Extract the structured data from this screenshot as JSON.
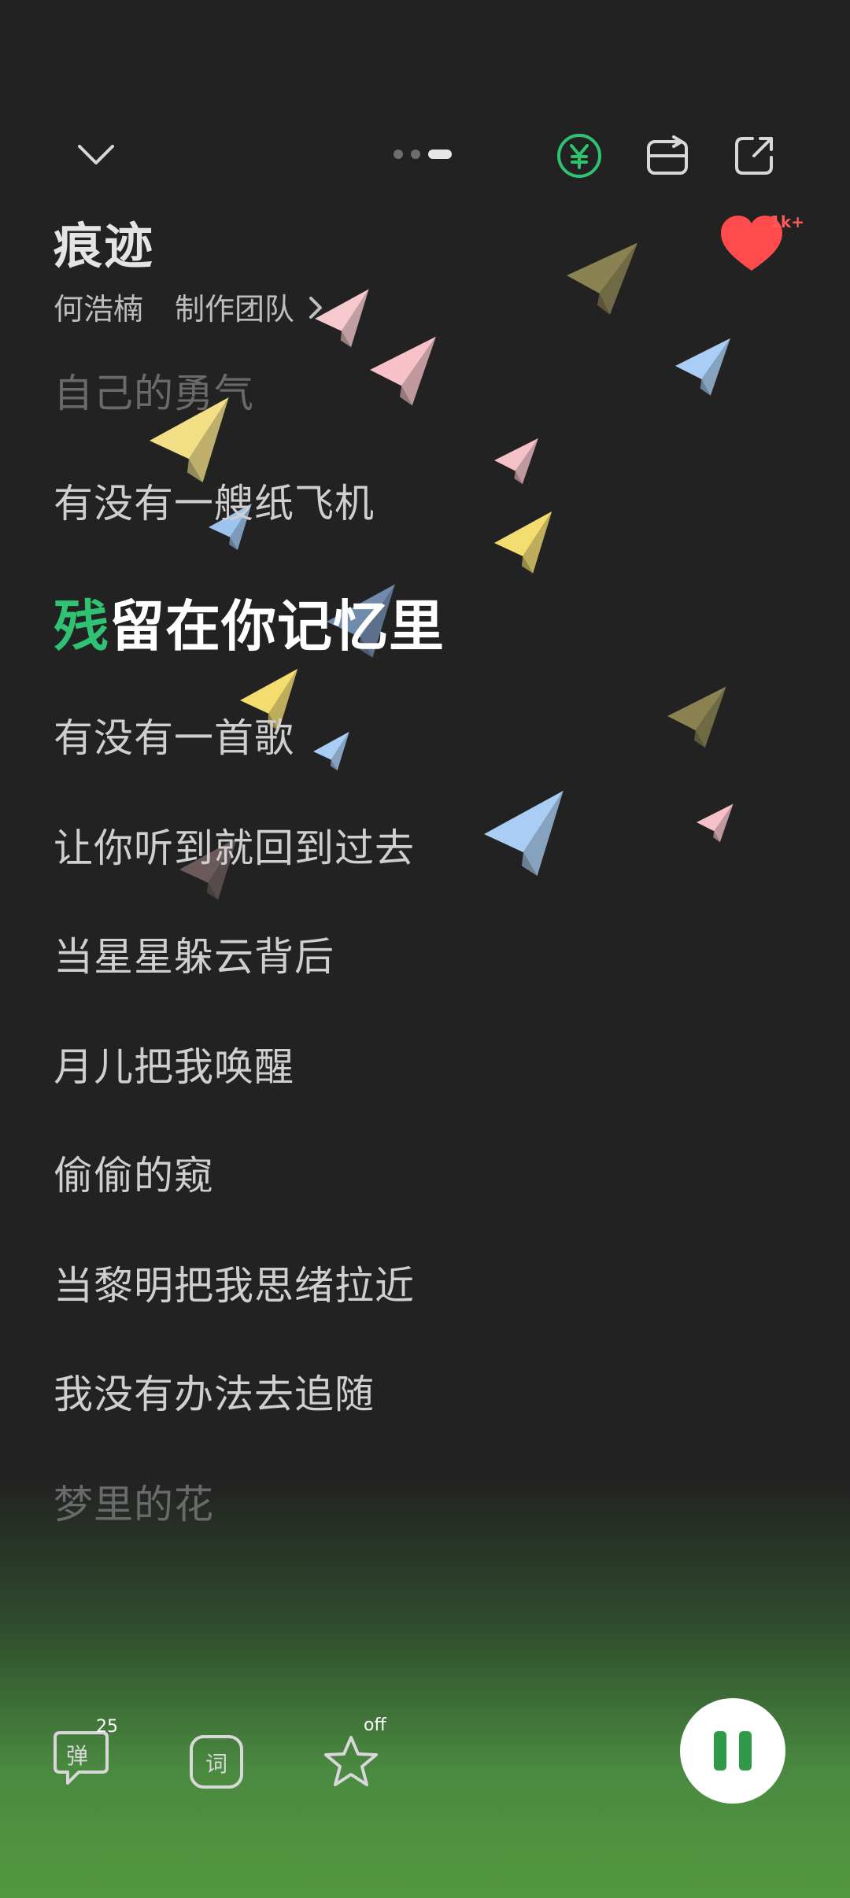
{
  "header": {
    "collapse_icon": "chevron-down-icon",
    "vip_icon": "yen-circle-icon",
    "flip_icon": "flip-card-icon",
    "share_icon": "share-icon",
    "page_indicator": {
      "count": 3,
      "active": 3
    }
  },
  "song": {
    "title": "痕迹",
    "artist": "何浩楠",
    "credits": "制作团队",
    "like_count": "1k+"
  },
  "lyrics": [
    "自己的勇气",
    "有没有一艘纸飞机",
    "残",
    "留在你记忆里",
    "有没有一首歌",
    "让你听到就回到过去",
    "当星星躲云背后",
    "月儿把我唤醒",
    "偷偷的窥",
    "当黎明把我思绪拉近",
    "我没有办法去追随",
    "梦里的花"
  ],
  "controls": {
    "danmaku_label": "弹",
    "danmaku_count": "25",
    "lyrics_label": "词",
    "effect_badge": "off",
    "effect_icon": "star-outline-icon",
    "play_state": "pause-icon"
  },
  "colors": {
    "highlight": "#2fc272",
    "accent_green": "#4a8a40",
    "like_red": "#ff4b4b"
  }
}
